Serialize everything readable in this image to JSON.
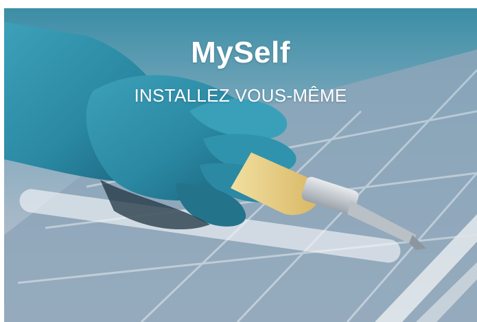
{
  "banner": {
    "title": "MySelf",
    "subtitle": "INSTALLEZ VOUS-MÊME"
  },
  "photo": {
    "subject": "gloved-hand-sealant-gun-solar-panel-icon",
    "colors": {
      "glove": "#2f8fa8",
      "glove_dark": "#1f6d86",
      "sealant": "#e9d08a",
      "nozzle": "#c8ccd0",
      "panel": "#8fa7bb",
      "panel_grid": "#d7e1ea"
    }
  }
}
